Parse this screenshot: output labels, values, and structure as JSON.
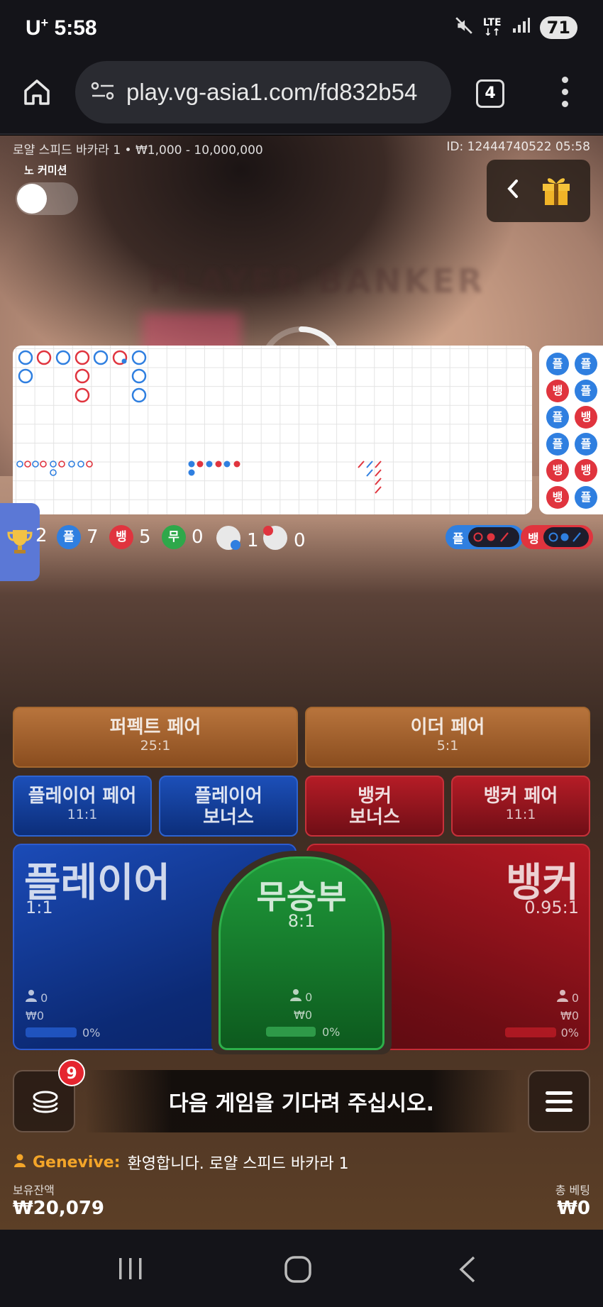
{
  "status": {
    "carrier": "U",
    "carrier_sup": "+",
    "time": "5:58",
    "network": "LTE",
    "battery": "71"
  },
  "browser": {
    "url": "play.vg-asia1.com/fd832b54",
    "tab_count": "4"
  },
  "game": {
    "table_info": "로얄 스피드 바카라 1 • ₩1,000 - 10,000,000",
    "round_id": "ID: 12444740522 05:58",
    "no_commission_label": "노 커미션",
    "blurred_table_text": "PLAYER  BANKER"
  },
  "road_side": [
    {
      "label": "플",
      "color": "#2f7fe0"
    },
    {
      "label": "뱅",
      "color": "#e0343e"
    },
    {
      "label": "플",
      "color": "#2f7fe0"
    },
    {
      "label": "플",
      "color": "#2f7fe0"
    },
    {
      "label": "뱅",
      "color": "#e0343e"
    },
    {
      "label": "뱅",
      "color": "#e0343e"
    },
    {
      "label": "플",
      "color": "#2f7fe0"
    },
    {
      "label": "플",
      "color": "#2f7fe0"
    },
    {
      "label": "뱅",
      "color": "#e0343e"
    },
    {
      "label": "플",
      "color": "#2f7fe0"
    },
    {
      "label": "뱅",
      "color": "#e0343e"
    },
    {
      "label": "플",
      "color": "#2f7fe0"
    }
  ],
  "counts": {
    "total": "2",
    "player_chip": "플",
    "player": "7",
    "banker_chip": "뱅",
    "banker": "5",
    "tie_chip": "무",
    "tie": "0",
    "player_pair": "1",
    "banker_pair": "0",
    "predict_player": "플",
    "predict_banker": "뱅"
  },
  "bets": {
    "perfect_pair": {
      "label": "퍼펙트 페어",
      "odds": "25:1"
    },
    "either_pair": {
      "label": "이더 페어",
      "odds": "5:1"
    },
    "player_pair": {
      "label": "플레이어 페어",
      "odds": "11:1"
    },
    "player_bonus": {
      "label_1": "플레이어",
      "label_2": "보너스"
    },
    "banker_bonus": {
      "label_1": "뱅커",
      "label_2": "보너스"
    },
    "banker_pair": {
      "label": "뱅커 페어",
      "odds": "11:1"
    },
    "player": {
      "label": "플레이어",
      "odds": "1:1",
      "players": "0",
      "amount": "₩0",
      "percent": "0%",
      "percent_value": 0
    },
    "tie": {
      "label": "무승부",
      "odds": "8:1",
      "players": "0",
      "amount": "₩0",
      "percent": "0%",
      "percent_value": 0
    },
    "banker": {
      "label": "뱅커",
      "odds": "0.95:1",
      "players": "0",
      "amount": "₩0",
      "percent": "0%",
      "percent_value": 0
    }
  },
  "controls": {
    "chip_badge": "9",
    "message": "다음 게임을 기다려 주십시오."
  },
  "chat": {
    "user": "Genevive:",
    "text": "환영합니다. 로얄 스피드 바카라 1"
  },
  "footer": {
    "balance_label": "보유잔액",
    "balance": "₩20,079",
    "total_bet_label": "총 베팅",
    "total_bet": "₩0"
  },
  "colors": {
    "player_blue": "#2f7fe0",
    "banker_red": "#e0343e",
    "tie_green": "#2ea84a",
    "chat_user": "#f3a529"
  }
}
